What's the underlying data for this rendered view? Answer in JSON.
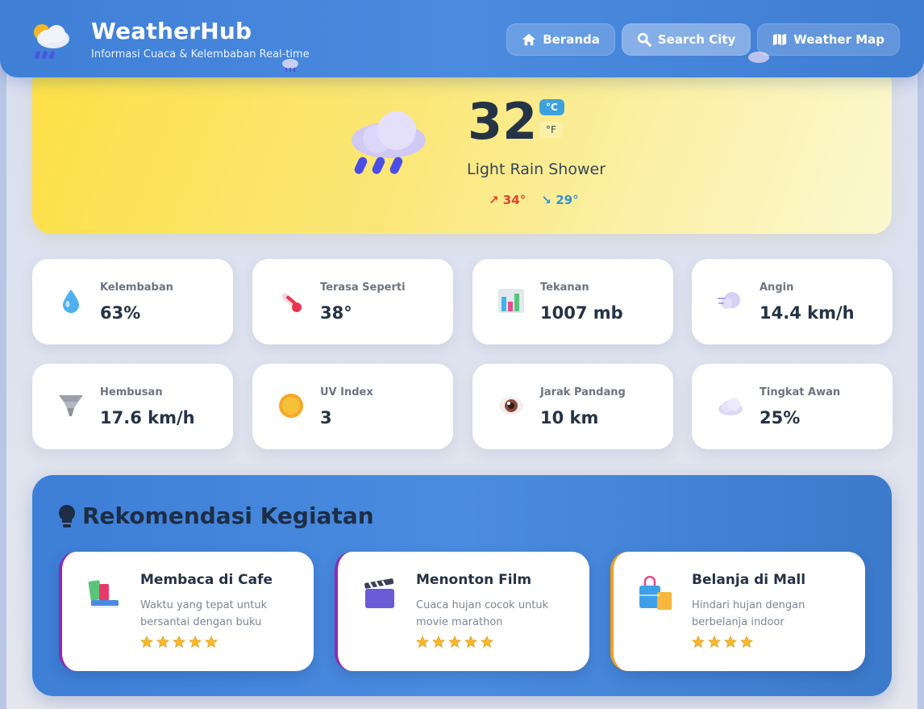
{
  "header": {
    "title": "WeatherHub",
    "subtitle": "Informasi Cuaca & Kelembaban Real-time",
    "nav": [
      {
        "label": "Beranda",
        "icon": "home-icon"
      },
      {
        "label": "Search City",
        "icon": "search-icon",
        "active": true
      },
      {
        "label": "Weather Map",
        "icon": "map-icon"
      }
    ]
  },
  "current": {
    "temperature": "32",
    "unit_c": "°C",
    "unit_f": "°F",
    "condition": "Light Rain Shower",
    "high": "↗ 34°",
    "low": "↘ 29°",
    "icon": "rain-cloud-icon"
  },
  "stats": [
    {
      "label": "Kelembaban",
      "value": "63%",
      "icon": "droplet-icon"
    },
    {
      "label": "Terasa Seperti",
      "value": "38°",
      "icon": "thermometer-icon"
    },
    {
      "label": "Tekanan",
      "value": "1007 mb",
      "icon": "bar-chart-icon"
    },
    {
      "label": "Angin",
      "value": "14.4 km/h",
      "icon": "wind-icon"
    },
    {
      "label": "Hembusan",
      "value": "17.6 km/h",
      "icon": "tornado-icon"
    },
    {
      "label": "UV Index",
      "value": "3",
      "icon": "sun-icon"
    },
    {
      "label": "Jarak Pandang",
      "value": "10 km",
      "icon": "eye-icon"
    },
    {
      "label": "Tingkat Awan",
      "value": "25%",
      "icon": "cloud-icon"
    }
  ],
  "recommendations": {
    "title": "Rekomendasi Kegiatan",
    "items": [
      {
        "title": "Membaca di Cafe",
        "desc": "Waktu yang tepat untuk bersantai dengan buku",
        "rating": 5,
        "icon": "books-icon",
        "accent": "#8e2bb5"
      },
      {
        "title": "Menonton Film",
        "desc": "Cuaca hujan cocok untuk movie marathon",
        "rating": 5,
        "icon": "clapperboard-icon",
        "accent": "#8e2bb5"
      },
      {
        "title": "Belanja di Mall",
        "desc": "Hindari hujan dengan berbelanja indoor",
        "rating": 4,
        "icon": "shopping-bags-icon",
        "accent": "#f0a020"
      }
    ]
  },
  "colors": {
    "header_blue": "#4a8be0",
    "hero_yellow": "#fde046",
    "text_dark": "#253346",
    "high_red": "#e0442e",
    "low_blue": "#3592d8"
  }
}
